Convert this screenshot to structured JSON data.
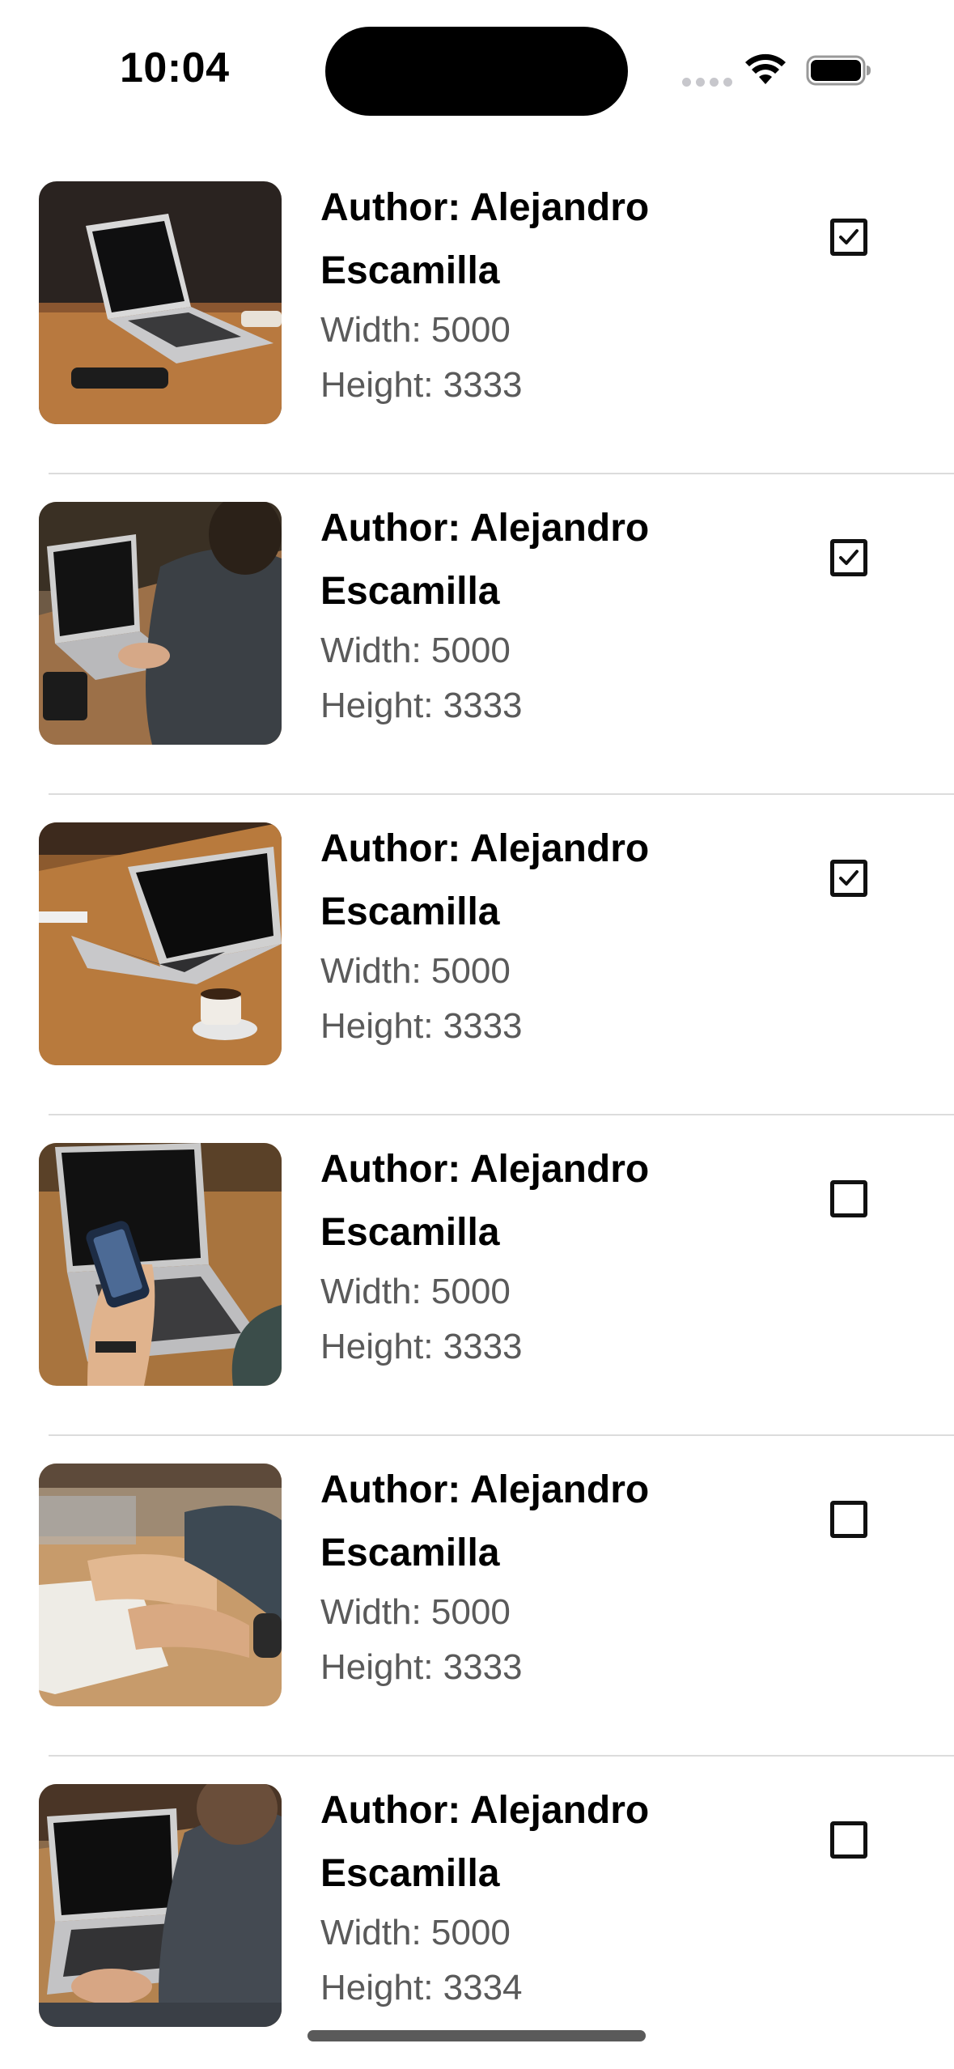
{
  "status_bar": {
    "time": "10:04"
  },
  "items": [
    {
      "author": "Author: Alejandro Escamilla",
      "width": "Width: 5000",
      "height": "Height: 3333",
      "checked": true,
      "icon": "laptop-on-desk-photo"
    },
    {
      "author": "Author: Alejandro Escamilla",
      "width": "Width: 5000",
      "height": "Height: 3333",
      "checked": true,
      "icon": "person-typing-laptop-photo"
    },
    {
      "author": "Author: Alejandro Escamilla",
      "width": "Width: 5000",
      "height": "Height: 3333",
      "checked": true,
      "icon": "laptop-with-coffee-photo"
    },
    {
      "author": "Author: Alejandro Escamilla",
      "width": "Width: 5000",
      "height": "Height: 3333",
      "checked": false,
      "icon": "phone-and-laptop-photo"
    },
    {
      "author": "Author: Alejandro Escamilla",
      "width": "Width: 5000",
      "height": "Height: 3333",
      "checked": false,
      "icon": "hands-on-notebook-photo"
    },
    {
      "author": "Author: Alejandro Escamilla",
      "width": "Width: 5000",
      "height": "Height: 3334",
      "checked": false,
      "icon": "typing-laptop-photo"
    }
  ]
}
